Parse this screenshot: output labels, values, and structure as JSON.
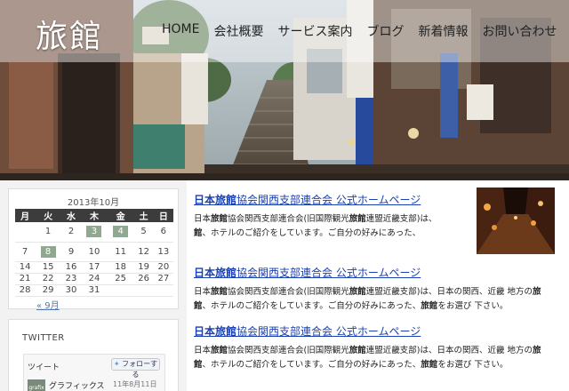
{
  "site": {
    "logo": "旅館"
  },
  "nav": {
    "items": [
      {
        "label": "HOME"
      },
      {
        "label": "会社概要"
      },
      {
        "label": "サービス案内"
      },
      {
        "label": "ブログ"
      },
      {
        "label": "新着情報"
      },
      {
        "label": "お問い合わせ"
      }
    ]
  },
  "calendar": {
    "caption": "2013年10月",
    "weekdays": [
      "月",
      "火",
      "水",
      "木",
      "金",
      "土",
      "日"
    ],
    "weeks": [
      [
        "",
        "1",
        "2",
        "3",
        "4",
        "5",
        "6"
      ],
      [
        "7",
        "8",
        "9",
        "10",
        "11",
        "12",
        "13"
      ],
      [
        "14",
        "15",
        "16",
        "17",
        "18",
        "19",
        "20"
      ],
      [
        "21",
        "22",
        "23",
        "24",
        "25",
        "26",
        "27"
      ],
      [
        "28",
        "29",
        "30",
        "31",
        "",
        "",
        ""
      ]
    ],
    "highlighted": [
      "3",
      "4",
      "8"
    ],
    "prev_link": "« 9月"
  },
  "twitter": {
    "title": "TWITTER",
    "tweet_label": "ツイート",
    "follow_label": "フォローする",
    "avatar_text": "grafix",
    "name": "グラフィックス",
    "date": "11年8月11日"
  },
  "posts": [
    {
      "title_parts": [
        "日本旅館",
        "協会関西支部連合会 公式ホームページ"
      ],
      "text_lines": [
        [
          "日本",
          "旅館",
          "協会関西支部連合会(旧国際観光",
          "旅館",
          "連盟近畿支部)は、"
        ],
        [
          "",
          "館",
          "、ホテルのご紹介をしています。ご自分の好みにあった、"
        ]
      ]
    },
    {
      "title_parts": [
        "日本旅館",
        "協会関西支部連合会 公式ホームページ"
      ],
      "text_lines": [
        [
          "日本",
          "旅館",
          "協会関西支部連合会(旧国際観光",
          "旅館",
          "連盟近畿支部)は、日本の関西、近畿 地方の",
          "旅"
        ],
        [
          "",
          "館",
          "、ホテルのご紹介をしています。ご自分の好みにあった、",
          "旅館",
          "をお選び 下さい。"
        ]
      ]
    },
    {
      "title_parts": [
        "日本旅館",
        "協会関西支部連合会 公式ホームページ"
      ],
      "text_lines": [
        [
          "日本",
          "旅館",
          "協会関西支部連合会(旧国際観光",
          "旅館",
          "連盟近畿支部)は、日本の関西、近畿 地方の",
          "旅"
        ],
        [
          "",
          "館",
          "、ホテルのご紹介をしています。ご自分の好みにあった、",
          "旅館",
          "をお選び 下さい。"
        ]
      ]
    }
  ]
}
